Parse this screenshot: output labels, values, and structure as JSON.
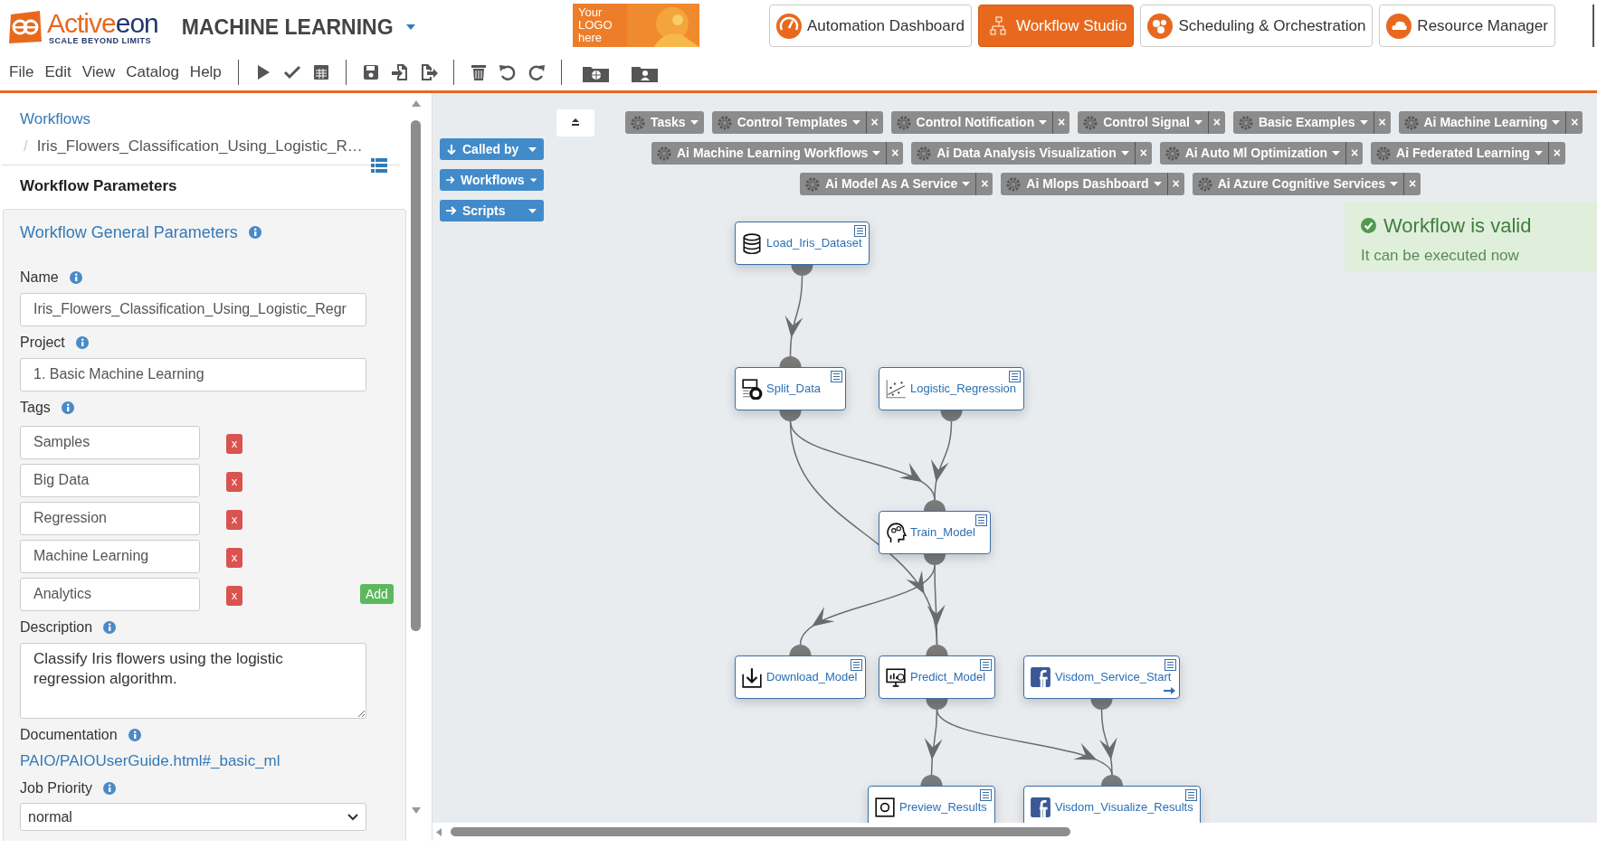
{
  "header": {
    "logo_parts": [
      {
        "text": "Active",
        "color": "#e8691e"
      },
      {
        "text": "eon",
        "color": "#22386b"
      }
    ],
    "logo_tagline": "SCALE BEYOND LIMITS",
    "app_title": "MACHINE LEARNING",
    "logo_placeholder": "Your LOGO here"
  },
  "portals": [
    {
      "label": "Automation Dashboard",
      "selected": false
    },
    {
      "label": "Workflow Studio",
      "selected": true
    },
    {
      "label": "Scheduling & Orchestration",
      "selected": false
    },
    {
      "label": "Resource Manager",
      "selected": false
    }
  ],
  "menu": [
    "File",
    "Edit",
    "View",
    "Catalog",
    "Help"
  ],
  "breadcrumb": {
    "root": "Workflows",
    "separator": "/",
    "current": "Iris_Flowers_Classification_Using_Logistic_R…"
  },
  "panel_title": "Workflow Parameters",
  "section_title": "Workflow General Parameters",
  "name": {
    "label": "Name",
    "value": "Iris_Flowers_Classification_Using_Logistic_Regr"
  },
  "project": {
    "label": "Project",
    "value": "1. Basic Machine Learning"
  },
  "tags": {
    "label": "Tags",
    "add_label": "Add",
    "items": [
      {
        "value": "Samples",
        "remove": "x"
      },
      {
        "value": "Big Data",
        "remove": "x"
      },
      {
        "value": "Regression",
        "remove": "x"
      },
      {
        "value": "Machine Learning",
        "remove": "x"
      },
      {
        "value": "Analytics",
        "remove": "x"
      }
    ]
  },
  "description": {
    "label": "Description",
    "value": "Classify Iris flowers using the logistic regression algorithm."
  },
  "documentation": {
    "label": "Documentation",
    "link": "PAIO/PAIOUserGuide.html#_basic_ml"
  },
  "job_priority": {
    "label": "Job Priority",
    "value": "normal"
  },
  "side_buttons": [
    "Called by",
    "Workflows",
    "Scripts"
  ],
  "palette": [
    [
      {
        "label": "Tasks",
        "closable": false
      },
      {
        "label": "Control Templates",
        "closable": true
      },
      {
        "label": "Control Notification",
        "closable": true
      },
      {
        "label": "Control Signal",
        "closable": true
      },
      {
        "label": "Basic Examples",
        "closable": true
      },
      {
        "label": "Ai Machine Learning",
        "closable": true
      }
    ],
    [
      {
        "label": "Ai Machine Learning Workflows",
        "closable": true
      },
      {
        "label": "Ai Data Analysis Visualization",
        "closable": true
      },
      {
        "label": "Ai Auto Ml Optimization",
        "closable": true
      },
      {
        "label": "Ai Federated Learning",
        "closable": true
      }
    ],
    [
      {
        "label": "Ai Model As A Service",
        "closable": true
      },
      {
        "label": "Ai Mlops Dashboard",
        "closable": true
      },
      {
        "label": "Ai Azure Cognitive Services",
        "closable": true
      }
    ]
  ],
  "close_mark": "×",
  "toast": {
    "title": "Workflow is valid",
    "message": "It can be executed now"
  },
  "nodes": [
    {
      "label": "Load_Iris_Dataset"
    },
    {
      "label": "Split_Data"
    },
    {
      "label": "Logistic_Regression"
    },
    {
      "label": "Train_Model"
    },
    {
      "label": "Download_Model"
    },
    {
      "label": "Predict_Model"
    },
    {
      "label": "Visdom_Service_Start"
    },
    {
      "label": "Preview_Results"
    },
    {
      "label": "Visdom_Visualize_Results"
    }
  ]
}
